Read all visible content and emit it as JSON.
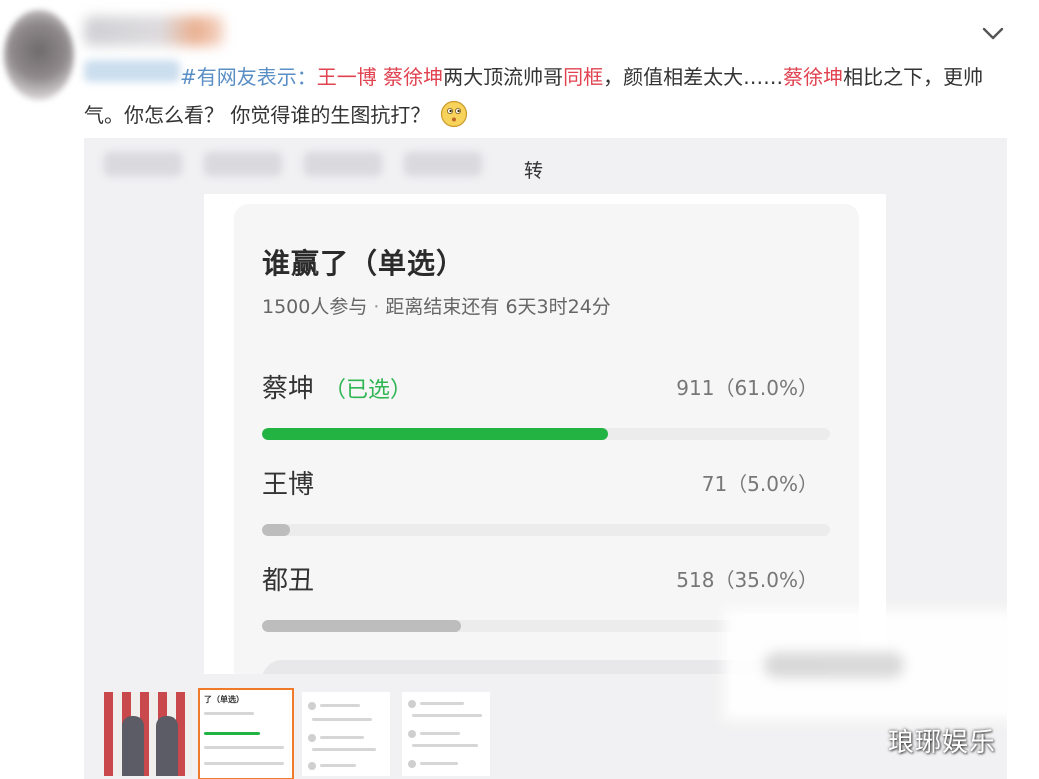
{
  "post": {
    "hashtag": "#有网友表示：",
    "segments": [
      {
        "text": "王一博 蔡徐坤",
        "highlight": true
      },
      {
        "text": "两大顶流帅哥",
        "highlight": false
      },
      {
        "text": "同框",
        "highlight": true
      },
      {
        "text": "，颜值相差太大……",
        "highlight": false
      },
      {
        "text": "蔡徐坤",
        "highlight": true
      },
      {
        "text": "相比之下，更帅气。你怎么看？ 你觉得谁的生图抗打？",
        "highlight": false
      }
    ],
    "emoji_icon": "thinking-face-icon"
  },
  "colors": {
    "highlight": "#e0424f",
    "hashtag": "#5a8fc6",
    "bar_selected": "#23b342",
    "bar_default": "#bdbdbd",
    "thumb_active_border": "#ee7a2a"
  },
  "media": {
    "repost_label": "转"
  },
  "poll": {
    "title": "谁赢了（单选）",
    "participants": "1500人参与",
    "separator": "·",
    "time_left": "距离结束还有 6天3时24分",
    "selected_label": "（已选）",
    "options": [
      {
        "name": "蔡坤",
        "stat": "911（61.0%）",
        "fraction": 0.61,
        "selected": true
      },
      {
        "name": "王博",
        "stat": "71（5.0%）",
        "fraction": 0.05,
        "selected": false
      },
      {
        "name": "都丑",
        "stat": "518（35.0%）",
        "fraction": 0.35,
        "selected": false
      }
    ]
  },
  "thumbnails": {
    "active_index": 1,
    "poll_thumb_title": "了（单选）"
  },
  "watermark": "琅琊娱乐"
}
